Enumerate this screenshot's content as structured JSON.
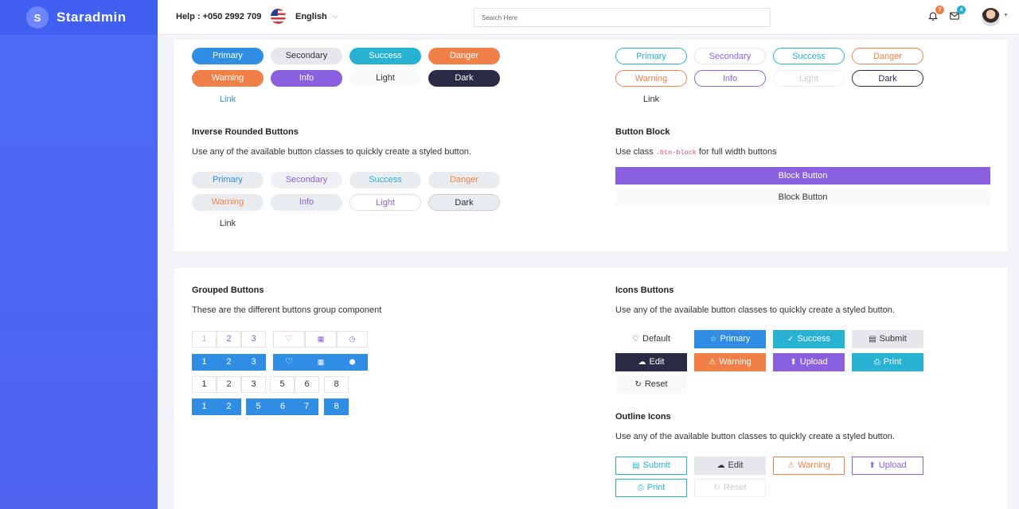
{
  "brand": {
    "logo_letter": "S",
    "name": "Staradmin"
  },
  "navbar": {
    "help": "Help : +050 2992 709",
    "language": "English",
    "search_placeholder": "Search Here",
    "notifications_count": "7",
    "messages_count": "4"
  },
  "rounded_buttons": {
    "filled": [
      "Primary",
      "Secondary",
      "Success",
      "Danger",
      "Warning",
      "Info",
      "Light",
      "Dark"
    ],
    "filled_link": "Link",
    "outline": [
      "Primary",
      "Secondary",
      "Success",
      "Danger",
      "Warning",
      "Info",
      "Light",
      "Dark"
    ],
    "outline_link": "Link"
  },
  "inverse_rounded": {
    "title": "Inverse Rounded Buttons",
    "description": "Use any of the available button classes to quickly create a styled button.",
    "buttons": [
      "Primary",
      "Secondary",
      "Success",
      "Danger",
      "Warning",
      "Info",
      "Light",
      "Dark"
    ],
    "link": "Link"
  },
  "button_block": {
    "title": "Button Block",
    "desc_prefix": "Use class",
    "desc_code": ".btn-block",
    "desc_suffix": "for full width buttons",
    "primary_label": "Block Button",
    "light_label": "Block Button"
  },
  "grouped": {
    "title": "Grouped Buttons",
    "description": "These are the different buttons group component",
    "row1": [
      "1",
      "2",
      "3"
    ],
    "row2": [
      "1",
      "2",
      "3"
    ],
    "row3a": [
      "1",
      "2",
      "3"
    ],
    "row3b": [
      "5",
      "6"
    ],
    "row3c": [
      "8"
    ],
    "row4a": [
      "1",
      "2"
    ],
    "row4b": [
      "5",
      "6",
      "7"
    ],
    "row4c": [
      "8"
    ]
  },
  "icons_buttons": {
    "title": "Icons Buttons",
    "description": "Use any of the available button classes to quickly create a styled button.",
    "buttons": [
      {
        "label": "Default",
        "icon": "heart-icon"
      },
      {
        "label": "Primary",
        "icon": "star-icon"
      },
      {
        "label": "Success",
        "icon": "check-icon"
      },
      {
        "label": "Submit",
        "icon": "file-icon"
      },
      {
        "label": "Edit",
        "icon": "cloud-icon"
      },
      {
        "label": "Warning",
        "icon": "alert-icon"
      },
      {
        "label": "Upload",
        "icon": "upload-icon"
      },
      {
        "label": "Print",
        "icon": "printer-icon"
      },
      {
        "label": "Reset",
        "icon": "reload-icon"
      }
    ]
  },
  "outline_icons": {
    "title": "Outline Icons",
    "description": "Use any of the available button classes to quickly create a styled button.",
    "buttons": [
      {
        "label": "Submit",
        "icon": "file-icon"
      },
      {
        "label": "Edit",
        "icon": "cloud-icon"
      },
      {
        "label": "Warning",
        "icon": "alert-icon"
      },
      {
        "label": "Upload",
        "icon": "upload-icon"
      },
      {
        "label": "Print",
        "icon": "printer-icon"
      },
      {
        "label": "Reset",
        "icon": "reload-icon"
      }
    ]
  },
  "colors": {
    "primary": "#2f8de4",
    "secondary": "#e6e7eb",
    "success": "#27b1d2",
    "danger": "#f08048",
    "warning": "#f08048",
    "info": "#8a5fe0",
    "light": "#f8f9fa",
    "dark": "#2b2b45"
  }
}
